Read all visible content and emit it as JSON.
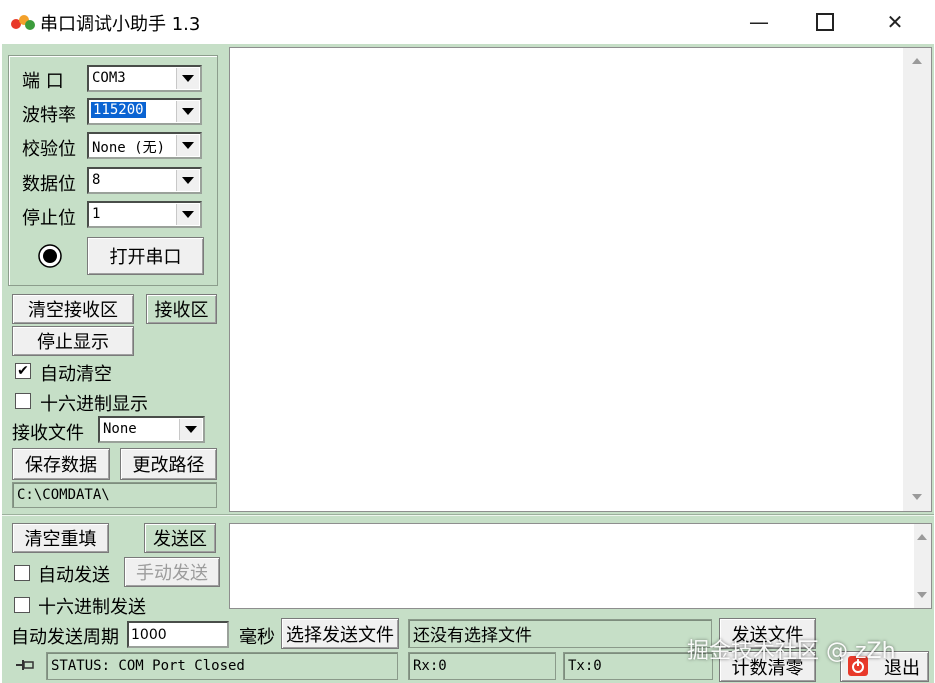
{
  "window": {
    "title": "串口调试小助手 1.3",
    "minimize_glyph": "—",
    "maximize_glyph": "☐",
    "close_glyph": "✕"
  },
  "port_settings": {
    "port_label": "端  口",
    "port_value": "COM3",
    "baud_label": "波特率",
    "baud_value": "115200",
    "parity_label": "校验位",
    "parity_value": "None (无)",
    "databits_label": "数据位",
    "databits_value": "8",
    "stopbits_label": "停止位",
    "stopbits_value": "1",
    "open_port_button": "打开串口"
  },
  "receive": {
    "clear_button": "清空接收区",
    "area_button": "接收区",
    "stop_display_button": "停止显示",
    "auto_clear_label": "自动清空",
    "auto_clear_checked": true,
    "hex_display_label": "十六进制显示",
    "hex_display_checked": false,
    "receive_file_label": "接收文件",
    "receive_file_value": "None",
    "save_data_button": "保存数据",
    "change_path_button": "更改路径",
    "path_value": "C:\\COMDATA\\"
  },
  "send": {
    "clear_button": "清空重填",
    "area_button": "发送区",
    "auto_send_label": "自动发送",
    "auto_send_checked": false,
    "manual_send_button": "手动发送",
    "hex_send_label": "十六进制发送",
    "hex_send_checked": false,
    "period_label": "自动发送周期",
    "period_value": "1000",
    "period_unit": "毫秒",
    "choose_file_button": "选择发送文件",
    "file_status": "还没有选择文件",
    "send_file_button": "发送文件"
  },
  "status_bar": {
    "status_text": "STATUS: COM Port Closed",
    "rx_text": "Rx:0",
    "tx_text": "Tx:0",
    "reset_count_button": "计数清零",
    "exit_button": "退出"
  },
  "watermark": "掘金技术社区 @ zZh",
  "icons": {
    "app": "app-icon",
    "indicator": "port-indicator-icon",
    "pin": "pin-icon",
    "exit": "exit-icon"
  },
  "colors": {
    "panel_bg": "#c6dfc7",
    "selection": "#0a63d2",
    "exit_icon": "#e8392a"
  }
}
